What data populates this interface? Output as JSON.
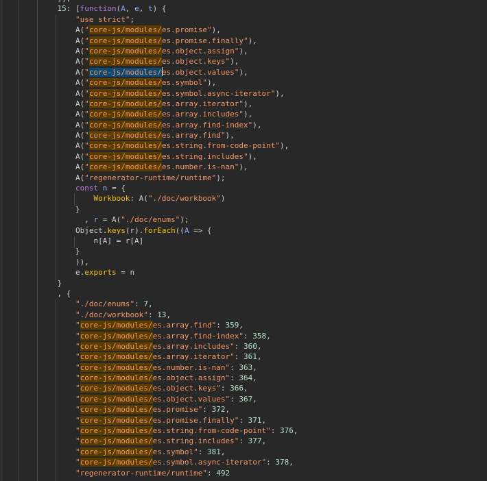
{
  "editor": {
    "colors": {
      "background": "#282828",
      "string": "#f29766",
      "search_match_bg": "#5a3c00",
      "current_match_bg": "#0c4a73",
      "keyword": "#b77fe0",
      "variable": "#7fb1f5",
      "property": "#f5c21a",
      "number": "#b6e3c9"
    },
    "search_query": "core-js/modules/",
    "lines": [
      [
        [
          "            ]],",
          "p"
        ]
      ],
      [
        [
          "            ",
          "p"
        ],
        [
          "15:",
          "ln"
        ],
        [
          " [",
          "p"
        ],
        [
          "function",
          "k"
        ],
        [
          "(",
          "p"
        ],
        [
          "A",
          "v"
        ],
        [
          ", ",
          "p"
        ],
        [
          "e",
          "v"
        ],
        [
          ", ",
          "p"
        ],
        [
          "t",
          "v"
        ],
        [
          ") {",
          "p"
        ]
      ],
      [
        [
          "                ",
          "p"
        ],
        [
          "\"use strict\"",
          "s"
        ],
        [
          ";",
          "p"
        ]
      ],
      [
        [
          "                A(",
          "p"
        ],
        [
          "\"",
          "s"
        ],
        [
          "core-js/modules/",
          "m"
        ],
        [
          "es.promise\"",
          "s"
        ],
        [
          "),",
          "p"
        ]
      ],
      [
        [
          "                A(",
          "p"
        ],
        [
          "\"",
          "s"
        ],
        [
          "core-js/modules/",
          "m"
        ],
        [
          "es.promise.finally\"",
          "s"
        ],
        [
          "),",
          "p"
        ]
      ],
      [
        [
          "                A(",
          "p"
        ],
        [
          "\"",
          "s"
        ],
        [
          "core-js/modules/",
          "m"
        ],
        [
          "es.object.assign\"",
          "s"
        ],
        [
          "),",
          "p"
        ]
      ],
      [
        [
          "                A(",
          "p"
        ],
        [
          "\"",
          "s"
        ],
        [
          "core-js/modules/",
          "m"
        ],
        [
          "es.object.keys\"",
          "s"
        ],
        [
          "),",
          "p"
        ]
      ],
      [
        [
          "                A(",
          "p"
        ],
        [
          "\"",
          "s"
        ],
        [
          "core-js/modules/",
          "mc"
        ],
        [
          "",
          "cursor"
        ],
        [
          "es.object.values\"",
          "s"
        ],
        [
          "),",
          "p"
        ]
      ],
      [
        [
          "                A(",
          "p"
        ],
        [
          "\"",
          "s"
        ],
        [
          "core-js/modules/",
          "m"
        ],
        [
          "es.symbol\"",
          "s"
        ],
        [
          "),",
          "p"
        ]
      ],
      [
        [
          "                A(",
          "p"
        ],
        [
          "\"",
          "s"
        ],
        [
          "core-js/modules/",
          "m"
        ],
        [
          "es.symbol.async-iterator\"",
          "s"
        ],
        [
          "),",
          "p"
        ]
      ],
      [
        [
          "                A(",
          "p"
        ],
        [
          "\"",
          "s"
        ],
        [
          "core-js/modules/",
          "m"
        ],
        [
          "es.array.iterator\"",
          "s"
        ],
        [
          "),",
          "p"
        ]
      ],
      [
        [
          "                A(",
          "p"
        ],
        [
          "\"",
          "s"
        ],
        [
          "core-js/modules/",
          "m"
        ],
        [
          "es.array.includes\"",
          "s"
        ],
        [
          "),",
          "p"
        ]
      ],
      [
        [
          "                A(",
          "p"
        ],
        [
          "\"",
          "s"
        ],
        [
          "core-js/modules/",
          "m"
        ],
        [
          "es.array.find-index\"",
          "s"
        ],
        [
          "),",
          "p"
        ]
      ],
      [
        [
          "                A(",
          "p"
        ],
        [
          "\"",
          "s"
        ],
        [
          "core-js/modules/",
          "m"
        ],
        [
          "es.array.find\"",
          "s"
        ],
        [
          "),",
          "p"
        ]
      ],
      [
        [
          "                A(",
          "p"
        ],
        [
          "\"",
          "s"
        ],
        [
          "core-js/modules/",
          "m"
        ],
        [
          "es.string.from-code-point\"",
          "s"
        ],
        [
          "),",
          "p"
        ]
      ],
      [
        [
          "                A(",
          "p"
        ],
        [
          "\"",
          "s"
        ],
        [
          "core-js/modules/",
          "m"
        ],
        [
          "es.string.includes\"",
          "s"
        ],
        [
          "),",
          "p"
        ]
      ],
      [
        [
          "                A(",
          "p"
        ],
        [
          "\"",
          "s"
        ],
        [
          "core-js/modules/",
          "m"
        ],
        [
          "es.number.is-nan\"",
          "s"
        ],
        [
          "),",
          "p"
        ]
      ],
      [
        [
          "                A(",
          "p"
        ],
        [
          "\"regenerator-runtime/runtime\"",
          "s"
        ],
        [
          ");",
          "p"
        ]
      ],
      [
        [
          "                ",
          "p"
        ],
        [
          "const",
          "k"
        ],
        [
          " ",
          "p"
        ],
        [
          "n",
          "v"
        ],
        [
          " = {",
          "p"
        ]
      ],
      [
        [
          "                    ",
          "p"
        ],
        [
          "Workbook",
          "pr"
        ],
        [
          ": A(",
          "p"
        ],
        [
          "\"./doc/workbook\"",
          "s"
        ],
        [
          ")",
          "p"
        ]
      ],
      [
        [
          "                }",
          "p"
        ]
      ],
      [
        [
          "                  , ",
          "p"
        ],
        [
          "r",
          "v"
        ],
        [
          " = A(",
          "p"
        ],
        [
          "\"./doc/enums\"",
          "s"
        ],
        [
          ");",
          "p"
        ]
      ],
      [
        [
          "                Object.",
          "p"
        ],
        [
          "keys",
          "pr"
        ],
        [
          "(r).",
          "p"
        ],
        [
          "forEach",
          "pr"
        ],
        [
          "((",
          "p"
        ],
        [
          "A",
          "v"
        ],
        [
          " => {",
          "p"
        ]
      ],
      [
        [
          "                    n[A] = r[A]",
          "p"
        ]
      ],
      [
        [
          "                }",
          "p"
        ]
      ],
      [
        [
          "                )),",
          "p"
        ]
      ],
      [
        [
          "                e.",
          "p"
        ],
        [
          "exports",
          "pr"
        ],
        [
          " = n",
          "p"
        ]
      ],
      [
        [
          "            }",
          "p"
        ]
      ],
      [
        [
          "            , {",
          "p"
        ]
      ],
      [
        [
          "                ",
          "p"
        ],
        [
          "\"./doc/enums\"",
          "s"
        ],
        [
          ": ",
          "p"
        ],
        [
          "7",
          "n"
        ],
        [
          ",",
          "p"
        ]
      ],
      [
        [
          "                ",
          "p"
        ],
        [
          "\"./doc/workbook\"",
          "s"
        ],
        [
          ": ",
          "p"
        ],
        [
          "13",
          "n"
        ],
        [
          ",",
          "p"
        ]
      ],
      [
        [
          "                ",
          "p"
        ],
        [
          "\"",
          "s"
        ],
        [
          "core-js/modules/",
          "m"
        ],
        [
          "es.array.find\"",
          "s"
        ],
        [
          ": ",
          "p"
        ],
        [
          "359",
          "n"
        ],
        [
          ",",
          "p"
        ]
      ],
      [
        [
          "                ",
          "p"
        ],
        [
          "\"",
          "s"
        ],
        [
          "core-js/modules/",
          "m"
        ],
        [
          "es.array.find-index\"",
          "s"
        ],
        [
          ": ",
          "p"
        ],
        [
          "358",
          "n"
        ],
        [
          ",",
          "p"
        ]
      ],
      [
        [
          "                ",
          "p"
        ],
        [
          "\"",
          "s"
        ],
        [
          "core-js/modules/",
          "m"
        ],
        [
          "es.array.includes\"",
          "s"
        ],
        [
          ": ",
          "p"
        ],
        [
          "360",
          "n"
        ],
        [
          ",",
          "p"
        ]
      ],
      [
        [
          "                ",
          "p"
        ],
        [
          "\"",
          "s"
        ],
        [
          "core-js/modules/",
          "m"
        ],
        [
          "es.array.iterator\"",
          "s"
        ],
        [
          ": ",
          "p"
        ],
        [
          "361",
          "n"
        ],
        [
          ",",
          "p"
        ]
      ],
      [
        [
          "                ",
          "p"
        ],
        [
          "\"",
          "s"
        ],
        [
          "core-js/modules/",
          "m"
        ],
        [
          "es.number.is-nan\"",
          "s"
        ],
        [
          ": ",
          "p"
        ],
        [
          "363",
          "n"
        ],
        [
          ",",
          "p"
        ]
      ],
      [
        [
          "                ",
          "p"
        ],
        [
          "\"",
          "s"
        ],
        [
          "core-js/modules/",
          "m"
        ],
        [
          "es.object.assign\"",
          "s"
        ],
        [
          ": ",
          "p"
        ],
        [
          "364",
          "n"
        ],
        [
          ",",
          "p"
        ]
      ],
      [
        [
          "                ",
          "p"
        ],
        [
          "\"",
          "s"
        ],
        [
          "core-js/modules/",
          "m"
        ],
        [
          "es.object.keys\"",
          "s"
        ],
        [
          ": ",
          "p"
        ],
        [
          "366",
          "n"
        ],
        [
          ",",
          "p"
        ]
      ],
      [
        [
          "                ",
          "p"
        ],
        [
          "\"",
          "s"
        ],
        [
          "core-js/modules/",
          "m"
        ],
        [
          "es.object.values\"",
          "s"
        ],
        [
          ": ",
          "p"
        ],
        [
          "367",
          "n"
        ],
        [
          ",",
          "p"
        ]
      ],
      [
        [
          "                ",
          "p"
        ],
        [
          "\"",
          "s"
        ],
        [
          "core-js/modules/",
          "m"
        ],
        [
          "es.promise\"",
          "s"
        ],
        [
          ": ",
          "p"
        ],
        [
          "372",
          "n"
        ],
        [
          ",",
          "p"
        ]
      ],
      [
        [
          "                ",
          "p"
        ],
        [
          "\"",
          "s"
        ],
        [
          "core-js/modules/",
          "m"
        ],
        [
          "es.promise.finally\"",
          "s"
        ],
        [
          ": ",
          "p"
        ],
        [
          "371",
          "n"
        ],
        [
          ",",
          "p"
        ]
      ],
      [
        [
          "                ",
          "p"
        ],
        [
          "\"",
          "s"
        ],
        [
          "core-js/modules/",
          "m"
        ],
        [
          "es.string.from-code-point\"",
          "s"
        ],
        [
          ": ",
          "p"
        ],
        [
          "376",
          "n"
        ],
        [
          ",",
          "p"
        ]
      ],
      [
        [
          "                ",
          "p"
        ],
        [
          "\"",
          "s"
        ],
        [
          "core-js/modules/",
          "m"
        ],
        [
          "es.string.includes\"",
          "s"
        ],
        [
          ": ",
          "p"
        ],
        [
          "377",
          "n"
        ],
        [
          ",",
          "p"
        ]
      ],
      [
        [
          "                ",
          "p"
        ],
        [
          "\"",
          "s"
        ],
        [
          "core-js/modules/",
          "m"
        ],
        [
          "es.symbol\"",
          "s"
        ],
        [
          ": ",
          "p"
        ],
        [
          "381",
          "n"
        ],
        [
          ",",
          "p"
        ]
      ],
      [
        [
          "                ",
          "p"
        ],
        [
          "\"",
          "s"
        ],
        [
          "core-js/modules/",
          "m"
        ],
        [
          "es.symbol.async-iterator\"",
          "s"
        ],
        [
          ": ",
          "p"
        ],
        [
          "378",
          "n"
        ],
        [
          ",",
          "p"
        ]
      ],
      [
        [
          "                ",
          "p"
        ],
        [
          "\"regenerator-runtime/runtime\"",
          "s"
        ],
        [
          ": ",
          "p"
        ],
        [
          "492",
          "n"
        ]
      ]
    ]
  }
}
